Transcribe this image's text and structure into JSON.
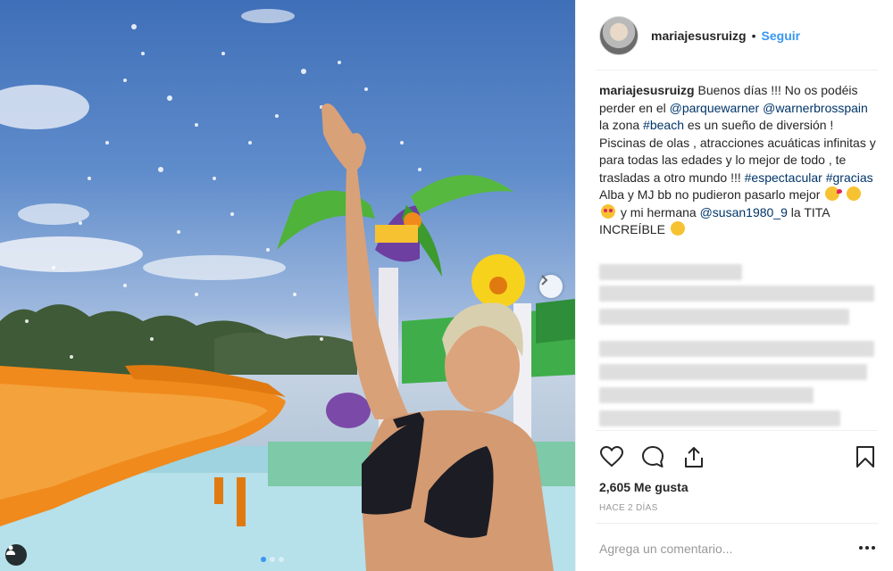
{
  "post": {
    "username": "mariajesusruizg",
    "separator": "•",
    "follow_label": "Seguir",
    "caption": {
      "username": "mariajesusruizg",
      "t1": " Buenos días !!! No os podéis perder en el ",
      "m1": "@parquewarner",
      "t2": " ",
      "m2": "@warnerbrosspain",
      "t3": " la zona ",
      "h1": "#beach",
      "t4": " es un sueño de diversión ! Piscinas de olas , atracciones acuáticas infinitas y para todas las edades y lo mejor de todo , te trasladas a otro mundo !!! ",
      "h2": "#espectacular",
      "t5": " ",
      "h3": "#gracias",
      "t6": " Alba y MJ bb no pudieron pasarlo mejor ",
      "t7": " y mi hermana ",
      "m3": "@susan1980_9",
      "t8": " la TITA INCREÍBLE "
    },
    "likes": "2,605 Me gusta",
    "date": "HACE 2 DÍAS",
    "comment_placeholder": "Agrega un comentario..."
  },
  "icons": {
    "like": "heart-icon",
    "comment": "comment-icon",
    "share": "share-icon",
    "save": "bookmark-icon",
    "next": "chevron-right-icon",
    "tag": "user-tag-icon",
    "more": "more-options-icon"
  },
  "colors": {
    "link": "#003569",
    "follow": "#3897f0",
    "text": "#262626",
    "muted": "#999999"
  }
}
